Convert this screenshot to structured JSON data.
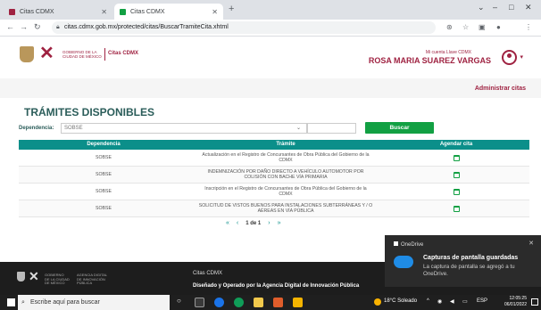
{
  "browser": {
    "tabs": [
      {
        "label": "Citas CDMX",
        "active": false
      },
      {
        "label": "Citas CDMX",
        "active": true
      }
    ],
    "url": "citas.cdmx.gob.mx/protected/citas/BuscarTramiteCita.xhtml"
  },
  "header": {
    "gov_text": "GOBIERNO DE LA CIUDAD DE MÉXICO",
    "app_title": "Citas CDMX",
    "account_label": "Mi cuenta Llave CDMX",
    "user_name": "ROSA MARIA SUAREZ VARGAS",
    "admin_link": "Administrar citas"
  },
  "main": {
    "title": "TRÁMITES DISPONIBLES",
    "filter_label": "Dependencia:",
    "selected_dependency": "SOBSE",
    "search_button": "Buscar"
  },
  "table": {
    "columns": [
      "Dependencia",
      "Trámite",
      "Agendar cita"
    ],
    "rows": [
      {
        "dependencia": "SOBSE",
        "tramite": "Actualización en el Registro de Concursantes de Obra Pública del Gobierno de la CDMX"
      },
      {
        "dependencia": "SOBSE",
        "tramite": "INDEMNIZACIÓN POR DAÑO DIRECTO A VEHÍCULO AUTOMOTOR POR COLISIÓN CON BACHE VÍA PRIMARIA"
      },
      {
        "dependencia": "SOBSE",
        "tramite": "Inscripción en el Registro de Concursantes de Obra Pública del Gobierno de la CDMX"
      },
      {
        "dependencia": "SOBSE",
        "tramite": "SOLICITUD DE VISTOS BUENOS PARA INSTALACIONES SUBTERRÁNEAS Y / O AÉREAS EN VÍA PÚBLICA"
      }
    ]
  },
  "pagination": {
    "first": "«",
    "prev": "‹",
    "info": "1 de 1",
    "next": "›",
    "last": "»"
  },
  "footer": {
    "gov_text": "GOBIERNO DE LA CIUDAD DE MÉXICO",
    "agency_text": "AGENCIA DIGITAL DE INNOVACIÓN PÚBLICA",
    "app_name": "Citas CDMX",
    "credit": "Diseñado y Operado por la Agencia Digital de Innovación Pública"
  },
  "notification": {
    "app": "OneDrive",
    "title": "Capturas de pantalla guardadas",
    "body": "La captura de pantalla se agregó a tu OneDrive."
  },
  "taskbar": {
    "search_placeholder": "Escribe aquí para buscar",
    "weather": "18°C Soleado",
    "language": "ESP",
    "time": "12:05:25",
    "date": "06/01/2022"
  },
  "colors": {
    "brand": "#9f2241",
    "teal": "#0b8f8a",
    "green": "#12a043"
  }
}
